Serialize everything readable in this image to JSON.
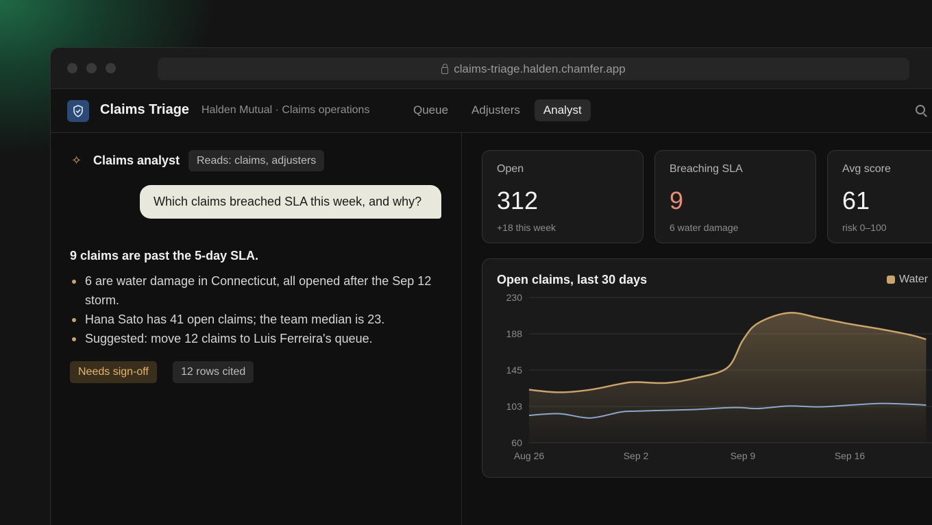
{
  "browser": {
    "url": "claims-triage.halden.chamfer.app"
  },
  "app": {
    "title": "Claims Triage",
    "subtitle": "Halden Mutual · Claims operations",
    "nav": [
      "Queue",
      "Adjusters",
      "Analyst"
    ],
    "active_nav": "Analyst"
  },
  "analyst": {
    "title": "Claims analyst",
    "reads": "Reads: claims, adjusters",
    "question": "Which claims breached SLA this week, and why?",
    "answer_head": "9 claims are past the 5-day SLA.",
    "bullets": [
      "6 are water damage in Connecticut, all opened after the Sep 12 storm.",
      "Hana Sato has 41 open claims; the team median is 23.",
      "Suggested: move 12 claims to Luis Ferreira's queue."
    ],
    "chip_signoff": "Needs sign-off",
    "chip_rows": "12 rows cited"
  },
  "kpis": [
    {
      "label": "Open",
      "value": "312",
      "sub": "+18 this week"
    },
    {
      "label": "Breaching SLA",
      "value": "9",
      "sub": "6 water damage"
    },
    {
      "label": "Avg score",
      "value": "61",
      "sub": "risk 0–100"
    }
  ],
  "colors": {
    "accent": "#c9a46c",
    "warn": "#e98d72",
    "secondary_series": "#8fa6cc",
    "logo_bg": "#2b4a78"
  },
  "chart_data": {
    "type": "area",
    "title": "Open claims, last 30 days",
    "ylim": [
      60,
      230
    ],
    "y_ticks": [
      "230",
      "188",
      "145",
      "103",
      "60"
    ],
    "x_ticks": [
      "Aug 26",
      "Sep 2",
      "Sep 9",
      "Sep 16"
    ],
    "x": [
      "Aug 26",
      "Aug 28",
      "Aug 30",
      "Sep 1",
      "Sep 2",
      "Sep 4",
      "Sep 6",
      "Sep 8",
      "Sep 9",
      "Sep 10",
      "Sep 12",
      "Sep 14",
      "Sep 16",
      "Sep 18",
      "Sep 20",
      "Sep 21"
    ],
    "series": [
      {
        "name": "Water",
        "values": [
          122,
          119,
          122,
          129,
          131,
          130,
          136,
          148,
          180,
          200,
          212,
          206,
          199,
          193,
          186,
          181
        ]
      },
      {
        "values": [
          92,
          94,
          89,
          96,
          97,
          98,
          99,
          101,
          101,
          100,
          103,
          102,
          104,
          106,
          105,
          104
        ]
      }
    ],
    "grid": true,
    "legend": "top-right"
  }
}
